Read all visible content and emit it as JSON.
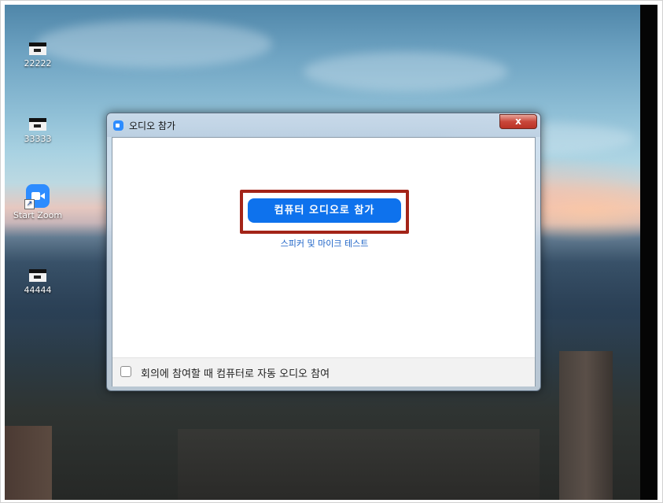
{
  "desktop": {
    "icons": [
      {
        "label": "22222",
        "icon": "window-icon"
      },
      {
        "label": "33333",
        "icon": "window-icon"
      },
      {
        "label": "Start Zoom",
        "icon": "zoom-app-icon"
      },
      {
        "label": "44444",
        "icon": "window-icon"
      }
    ]
  },
  "dialog": {
    "title": "오디오 참가",
    "close_label": "x",
    "join_button_label": "컴퓨터 오디오로 참가",
    "test_link_label": "스피커 및 마이크 테스트",
    "auto_join_checkbox_label": "회의에 참여할 때 컴퓨터로 자동 오디오 참여",
    "auto_join_checked": false
  },
  "colors": {
    "accent": "#0e72ed",
    "highlight_border": "#a32418",
    "link": "#1d63c7"
  }
}
